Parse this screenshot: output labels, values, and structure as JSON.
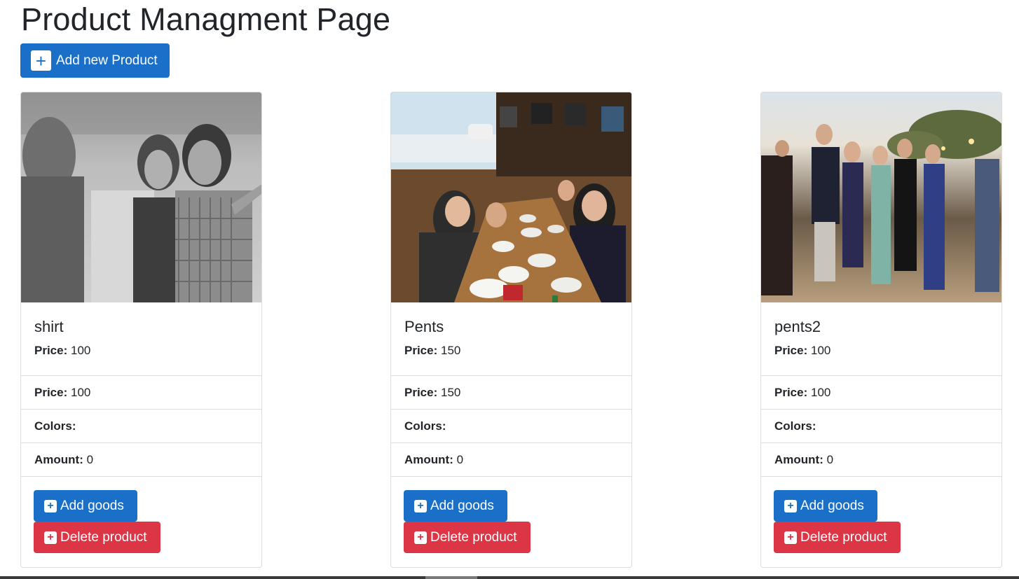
{
  "page": {
    "title": "Product Managment Page"
  },
  "toolbar": {
    "add_new_label": "Add new Product",
    "add_new_icon": "plus-icon"
  },
  "products": [
    {
      "name": "shirt",
      "price_label": "Price:",
      "price": "100",
      "colors_label": "Colors:",
      "colors": "",
      "amount_label": "Amount:",
      "amount": "0",
      "add_goods_label": "Add goods",
      "delete_label": "Delete product",
      "image": "grayscale photo of people outdoors"
    },
    {
      "name": "Pents",
      "price_label": "Price:",
      "price": "150",
      "colors_label": "Colors:",
      "colors": "",
      "amount_label": "Amount:",
      "amount": "0",
      "add_goods_label": "Add goods",
      "delete_label": "Delete product",
      "image": "group photo at a restaurant table"
    },
    {
      "name": "pents2",
      "price_label": "Price:",
      "price": "100",
      "colors_label": "Colors:",
      "colors": "",
      "amount_label": "Amount:",
      "amount": "0",
      "add_goods_label": "Add goods",
      "delete_label": "Delete product",
      "image": "group photo at an evening outdoor event"
    }
  ],
  "colors": {
    "primary": "#1a6fc9",
    "danger": "#dc3545",
    "border": "#dcdcdc",
    "text": "#212529"
  }
}
